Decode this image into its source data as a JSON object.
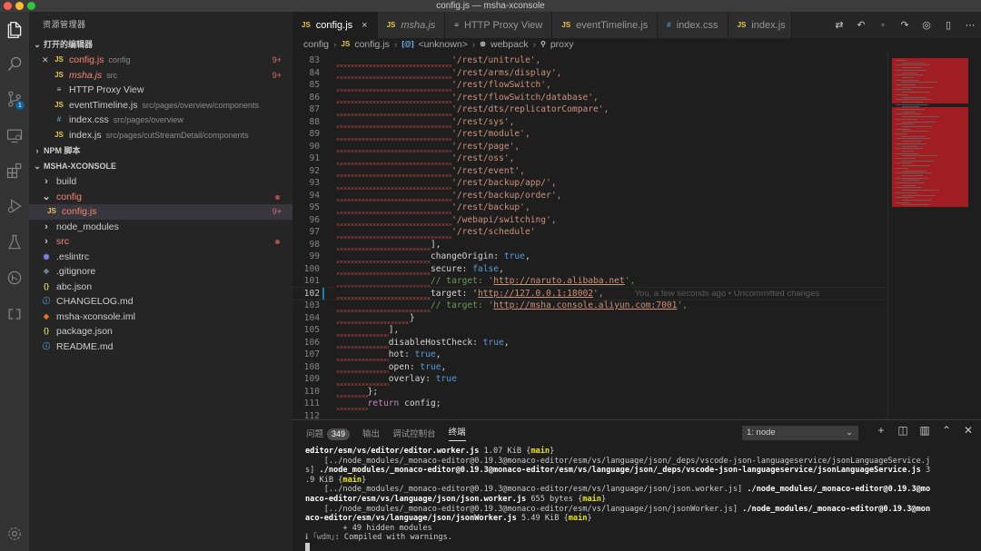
{
  "window": {
    "title": "config.js — msha-xconsole"
  },
  "colors": {
    "accent": "#0e639c",
    "error": "#f48771",
    "js": "#e8c64d",
    "css": "#519aba"
  },
  "activity_bar": {
    "icons": [
      "files-icon",
      "search-icon",
      "source-control-icon",
      "remote-explorer-icon",
      "extensions-icon",
      "run-debug-icon",
      "testing-icon",
      "gitlens-icon",
      "live-share-icon",
      "settings-gear-icon"
    ],
    "scm_badge": "1"
  },
  "sidebar": {
    "title": "资源管理器",
    "open_editors": {
      "label": "打开的编辑器",
      "items": [
        {
          "icon": "JS",
          "name": "config.js",
          "desc": "config",
          "count": "9+"
        },
        {
          "icon": "JS",
          "name": "msha.js",
          "desc": "src",
          "count": "9+"
        },
        {
          "icon": "≡",
          "name": "HTTP Proxy View",
          "desc": "",
          "count": ""
        },
        {
          "icon": "JS",
          "name": "eventTimeline.js",
          "desc": "src/pages/overview/components",
          "count": ""
        },
        {
          "icon": "#",
          "name": "index.css",
          "desc": "src/pages/overview",
          "count": ""
        },
        {
          "icon": "JS",
          "name": "index.js",
          "desc": "src/pages/cutStreamDetail/components",
          "count": ""
        }
      ]
    },
    "npm_section": {
      "label": "NPM 脚本"
    },
    "project": {
      "label": "MSHA-XCONSOLE",
      "items": [
        {
          "type": "folder",
          "name": "build",
          "count": ""
        },
        {
          "type": "folder-open",
          "name": "config",
          "count": ""
        },
        {
          "type": "js",
          "name": "config.js",
          "count": "9+"
        },
        {
          "type": "folder",
          "name": "node_modules",
          "count": ""
        },
        {
          "type": "folder",
          "name": "src",
          "count": ""
        },
        {
          "type": "eslint",
          "name": ".eslintrc",
          "count": ""
        },
        {
          "type": "git",
          "name": ".gitignore",
          "count": ""
        },
        {
          "type": "json",
          "name": "abc.json",
          "count": ""
        },
        {
          "type": "md",
          "name": "CHANGELOG.md",
          "count": ""
        },
        {
          "type": "xml",
          "name": "msha-xconsole.iml",
          "count": ""
        },
        {
          "type": "json",
          "name": "package.json",
          "count": ""
        },
        {
          "type": "md",
          "name": "README.md",
          "count": ""
        }
      ]
    }
  },
  "tabs": [
    {
      "icon": "JS",
      "label": "config.js",
      "active": true
    },
    {
      "icon": "JS",
      "label": "msha.js",
      "active": false
    },
    {
      "icon": "≡",
      "label": "HTTP Proxy View",
      "active": false
    },
    {
      "icon": "JS",
      "label": "eventTimeline.js",
      "active": false
    },
    {
      "icon": "#",
      "label": "index.css",
      "active": false
    },
    {
      "icon": "JS",
      "label": "index.js",
      "active": false
    }
  ],
  "tab_close": "×",
  "breadcrumb": [
    "config",
    "config.js",
    "<unknown>",
    "webpack",
    "proxy"
  ],
  "code": [
    {
      "n": "83",
      "ind": "                      ",
      "t": "'/rest/unitrule',",
      "k": "str"
    },
    {
      "n": "84",
      "ind": "                      ",
      "t": "'/rest/arms/display',",
      "k": "str"
    },
    {
      "n": "85",
      "ind": "                      ",
      "t": "'/rest/flowSwitch',",
      "k": "str"
    },
    {
      "n": "86",
      "ind": "                      ",
      "t": "'/rest/flowSwitch/database',",
      "k": "str"
    },
    {
      "n": "87",
      "ind": "                      ",
      "t": "'/rest/dts/replicatorCompare',",
      "k": "str"
    },
    {
      "n": "88",
      "ind": "                      ",
      "t": "'/rest/sys',",
      "k": "str"
    },
    {
      "n": "89",
      "ind": "                      ",
      "t": "'/rest/module',",
      "k": "str"
    },
    {
      "n": "90",
      "ind": "                      ",
      "t": "'/rest/page',",
      "k": "str"
    },
    {
      "n": "91",
      "ind": "                      ",
      "t": "'/rest/oss',",
      "k": "str"
    },
    {
      "n": "92",
      "ind": "                      ",
      "t": "'/rest/event',",
      "k": "str"
    },
    {
      "n": "93",
      "ind": "                      ",
      "t": "'/rest/backup/app/',",
      "k": "str"
    },
    {
      "n": "94",
      "ind": "                      ",
      "t": "'/rest/backup/order',",
      "k": "str"
    },
    {
      "n": "95",
      "ind": "                      ",
      "t": "'/rest/backup',",
      "k": "str"
    },
    {
      "n": "96",
      "ind": "                      ",
      "t": "'/webapi/switching',",
      "k": "str"
    },
    {
      "n": "97",
      "ind": "                      ",
      "t": "'/rest/schedule'",
      "k": "str"
    },
    {
      "n": "98",
      "ind": "                  ",
      "t": "],",
      "k": "p"
    },
    {
      "n": "99",
      "ind": "                  ",
      "t": "changeOrigin: ",
      "v": "true",
      "e": ",",
      "k": "kv"
    },
    {
      "n": "100",
      "ind": "                  ",
      "t": "secure: ",
      "v": "false",
      "e": ",",
      "k": "kv"
    },
    {
      "n": "101",
      "ind": "                  ",
      "t": "// target: '",
      "u": "http://naruto.alibaba.net",
      "e": "',",
      "k": "cm"
    },
    {
      "n": "102",
      "ind": "                  ",
      "t": "target: '",
      "u": "http://127.0.0.1:18002",
      "e": "',",
      "k": "target",
      "blame": "You, a few seconds ago • Uncommitted changes"
    },
    {
      "n": "103",
      "ind": "                  ",
      "t": "// target: '",
      "u": "http://msha.console.aliyun.com:7001",
      "e": "',",
      "k": "cm"
    },
    {
      "n": "104",
      "ind": "              ",
      "t": "}",
      "k": "p"
    },
    {
      "n": "105",
      "ind": "          ",
      "t": "],",
      "k": "p"
    },
    {
      "n": "106",
      "ind": "          ",
      "t": "disableHostCheck: ",
      "v": "true",
      "e": ",",
      "k": "kv"
    },
    {
      "n": "107",
      "ind": "          ",
      "t": "hot: ",
      "v": "true",
      "e": ",",
      "k": "kv"
    },
    {
      "n": "108",
      "ind": "          ",
      "t": "open: ",
      "v": "true",
      "e": ",",
      "k": "kv"
    },
    {
      "n": "109",
      "ind": "          ",
      "t": "overlay: ",
      "v": "true",
      "e": "",
      "k": "kv"
    },
    {
      "n": "110",
      "ind": "      ",
      "t": "};",
      "k": "p"
    },
    {
      "n": "111",
      "ind": "      ",
      "t": "return",
      "e": " config;",
      "k": "ret"
    },
    {
      "n": "112",
      "ind": "",
      "t": "",
      "k": "p"
    }
  ],
  "panel": {
    "tabs": [
      "问题",
      "输出",
      "调试控制台",
      "终端"
    ],
    "problems_count": "349",
    "active_tab": "终端",
    "terminal_select": "1: node",
    "actions": [
      "+",
      "⊟",
      "🗑",
      "︿",
      "✕"
    ]
  },
  "terminal_lines": [
    [
      {
        "t": "editor/esm/vs/editor/editor.worker.js ",
        "c": "tb"
      },
      {
        "t": "1.07 KiB "
      },
      {
        "t": "{",
        "c": ""
      },
      {
        "t": "main",
        "c": "ty"
      },
      {
        "t": "}"
      }
    ],
    [
      {
        "t": "    [../node_modules/_monaco-editor@0.19.3@monaco-editor/esm/vs/language/json/_deps/vscode-json-languageservice/jsonLanguageService.j"
      }
    ],
    [
      {
        "t": "s] "
      },
      {
        "t": "./node_modules/_monaco-editor@0.19.3@monaco-editor/esm/vs/language/json/_deps/vscode-json-languageservice/jsonLanguageService.js ",
        "c": "tb"
      },
      {
        "t": "3"
      }
    ],
    [
      {
        "t": ".9 KiB {"
      },
      {
        "t": "main",
        "c": "ty"
      },
      {
        "t": "}"
      }
    ],
    [
      {
        "t": "    [../node_modules/_monaco-editor@0.19.3@monaco-editor/esm/vs/language/json/json.worker.js] "
      },
      {
        "t": "./node_modules/_monaco-editor@0.19.3@mo",
        "c": "tb"
      }
    ],
    [
      {
        "t": "naco-editor/esm/vs/language/json/json.worker.js ",
        "c": "tb"
      },
      {
        "t": "655 bytes {"
      },
      {
        "t": "main",
        "c": "ty"
      },
      {
        "t": "}"
      }
    ],
    [
      {
        "t": "    [../node_modules/_monaco-editor@0.19.3@monaco-editor/esm/vs/language/json/jsonWorker.js] "
      },
      {
        "t": "./node_modules/_monaco-editor@0.19.3@mon",
        "c": "tb"
      }
    ],
    [
      {
        "t": "aco-editor/esm/vs/language/json/jsonWorker.js ",
        "c": "tb"
      },
      {
        "t": "5.49 KiB {"
      },
      {
        "t": "main",
        "c": "ty"
      },
      {
        "t": "}"
      }
    ],
    [
      {
        "t": "        + 49 hidden modules"
      }
    ],
    [
      {
        "t": "ℹ ",
        "c": "tg"
      },
      {
        "t": "｢wdm｣",
        "c": "tg"
      },
      {
        "t": ": Compiled with warnings."
      }
    ]
  ]
}
